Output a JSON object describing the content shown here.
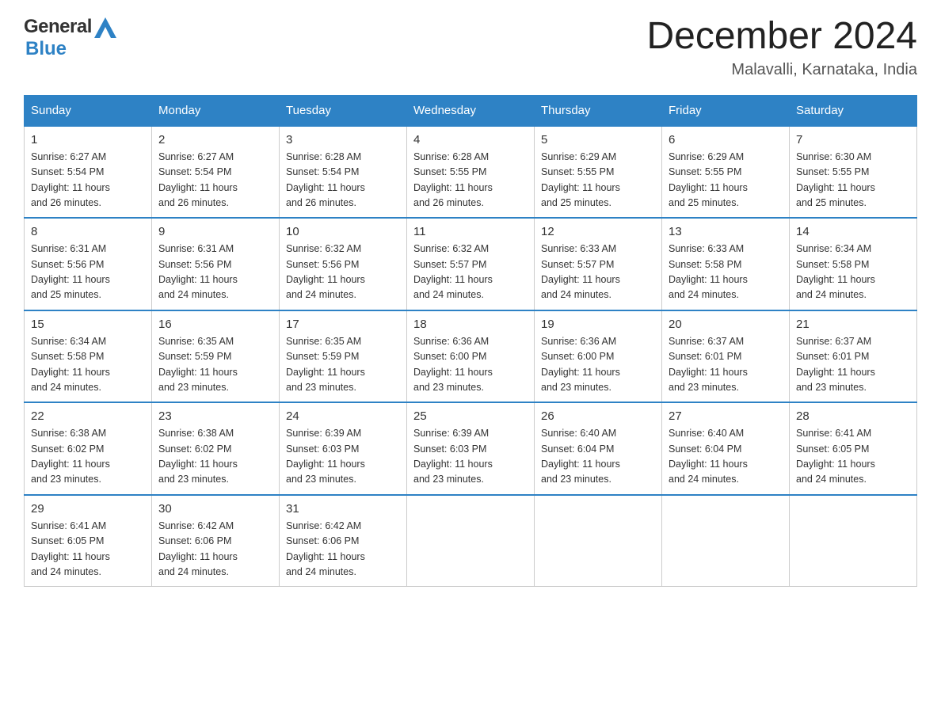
{
  "header": {
    "logo_general": "General",
    "logo_blue": "Blue",
    "month_title": "December 2024",
    "location": "Malavalli, Karnataka, India"
  },
  "days_of_week": [
    "Sunday",
    "Monday",
    "Tuesday",
    "Wednesday",
    "Thursday",
    "Friday",
    "Saturday"
  ],
  "weeks": [
    [
      {
        "day": "1",
        "sunrise": "6:27 AM",
        "sunset": "5:54 PM",
        "daylight": "11 hours and 26 minutes."
      },
      {
        "day": "2",
        "sunrise": "6:27 AM",
        "sunset": "5:54 PM",
        "daylight": "11 hours and 26 minutes."
      },
      {
        "day": "3",
        "sunrise": "6:28 AM",
        "sunset": "5:54 PM",
        "daylight": "11 hours and 26 minutes."
      },
      {
        "day": "4",
        "sunrise": "6:28 AM",
        "sunset": "5:55 PM",
        "daylight": "11 hours and 26 minutes."
      },
      {
        "day": "5",
        "sunrise": "6:29 AM",
        "sunset": "5:55 PM",
        "daylight": "11 hours and 25 minutes."
      },
      {
        "day": "6",
        "sunrise": "6:29 AM",
        "sunset": "5:55 PM",
        "daylight": "11 hours and 25 minutes."
      },
      {
        "day": "7",
        "sunrise": "6:30 AM",
        "sunset": "5:55 PM",
        "daylight": "11 hours and 25 minutes."
      }
    ],
    [
      {
        "day": "8",
        "sunrise": "6:31 AM",
        "sunset": "5:56 PM",
        "daylight": "11 hours and 25 minutes."
      },
      {
        "day": "9",
        "sunrise": "6:31 AM",
        "sunset": "5:56 PM",
        "daylight": "11 hours and 24 minutes."
      },
      {
        "day": "10",
        "sunrise": "6:32 AM",
        "sunset": "5:56 PM",
        "daylight": "11 hours and 24 minutes."
      },
      {
        "day": "11",
        "sunrise": "6:32 AM",
        "sunset": "5:57 PM",
        "daylight": "11 hours and 24 minutes."
      },
      {
        "day": "12",
        "sunrise": "6:33 AM",
        "sunset": "5:57 PM",
        "daylight": "11 hours and 24 minutes."
      },
      {
        "day": "13",
        "sunrise": "6:33 AM",
        "sunset": "5:58 PM",
        "daylight": "11 hours and 24 minutes."
      },
      {
        "day": "14",
        "sunrise": "6:34 AM",
        "sunset": "5:58 PM",
        "daylight": "11 hours and 24 minutes."
      }
    ],
    [
      {
        "day": "15",
        "sunrise": "6:34 AM",
        "sunset": "5:58 PM",
        "daylight": "11 hours and 24 minutes."
      },
      {
        "day": "16",
        "sunrise": "6:35 AM",
        "sunset": "5:59 PM",
        "daylight": "11 hours and 23 minutes."
      },
      {
        "day": "17",
        "sunrise": "6:35 AM",
        "sunset": "5:59 PM",
        "daylight": "11 hours and 23 minutes."
      },
      {
        "day": "18",
        "sunrise": "6:36 AM",
        "sunset": "6:00 PM",
        "daylight": "11 hours and 23 minutes."
      },
      {
        "day": "19",
        "sunrise": "6:36 AM",
        "sunset": "6:00 PM",
        "daylight": "11 hours and 23 minutes."
      },
      {
        "day": "20",
        "sunrise": "6:37 AM",
        "sunset": "6:01 PM",
        "daylight": "11 hours and 23 minutes."
      },
      {
        "day": "21",
        "sunrise": "6:37 AM",
        "sunset": "6:01 PM",
        "daylight": "11 hours and 23 minutes."
      }
    ],
    [
      {
        "day": "22",
        "sunrise": "6:38 AM",
        "sunset": "6:02 PM",
        "daylight": "11 hours and 23 minutes."
      },
      {
        "day": "23",
        "sunrise": "6:38 AM",
        "sunset": "6:02 PM",
        "daylight": "11 hours and 23 minutes."
      },
      {
        "day": "24",
        "sunrise": "6:39 AM",
        "sunset": "6:03 PM",
        "daylight": "11 hours and 23 minutes."
      },
      {
        "day": "25",
        "sunrise": "6:39 AM",
        "sunset": "6:03 PM",
        "daylight": "11 hours and 23 minutes."
      },
      {
        "day": "26",
        "sunrise": "6:40 AM",
        "sunset": "6:04 PM",
        "daylight": "11 hours and 23 minutes."
      },
      {
        "day": "27",
        "sunrise": "6:40 AM",
        "sunset": "6:04 PM",
        "daylight": "11 hours and 24 minutes."
      },
      {
        "day": "28",
        "sunrise": "6:41 AM",
        "sunset": "6:05 PM",
        "daylight": "11 hours and 24 minutes."
      }
    ],
    [
      {
        "day": "29",
        "sunrise": "6:41 AM",
        "sunset": "6:05 PM",
        "daylight": "11 hours and 24 minutes."
      },
      {
        "day": "30",
        "sunrise": "6:42 AM",
        "sunset": "6:06 PM",
        "daylight": "11 hours and 24 minutes."
      },
      {
        "day": "31",
        "sunrise": "6:42 AM",
        "sunset": "6:06 PM",
        "daylight": "11 hours and 24 minutes."
      },
      null,
      null,
      null,
      null
    ]
  ],
  "labels": {
    "sunrise_prefix": "Sunrise: ",
    "sunset_prefix": "Sunset: ",
    "daylight_prefix": "Daylight: "
  }
}
